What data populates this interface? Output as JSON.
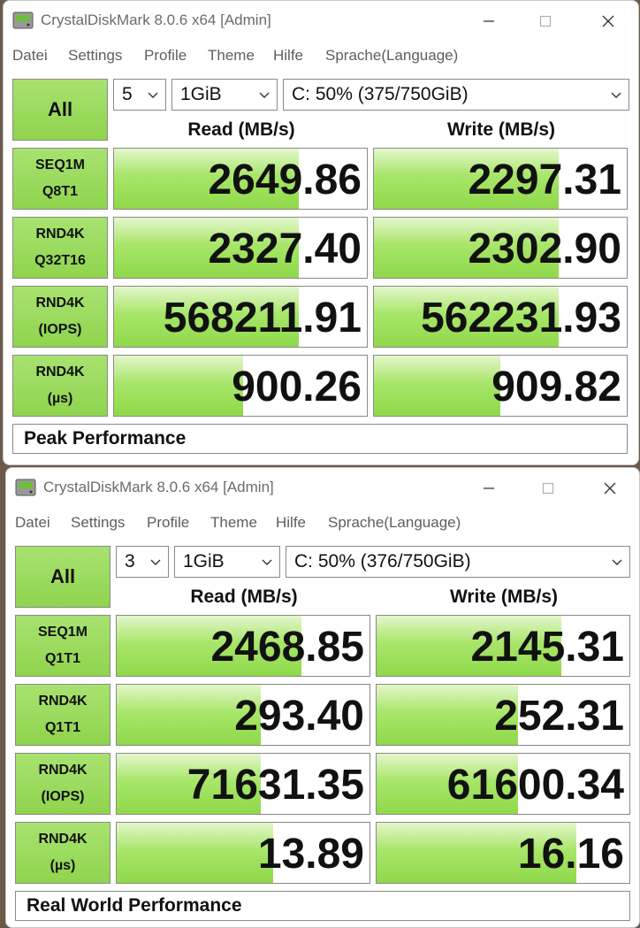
{
  "windows": [
    {
      "title": "CrystalDiskMark 8.0.6 x64 [Admin]",
      "menu": [
        "Datei",
        "Settings",
        "Profile",
        "Theme",
        "Hilfe",
        "Sprache(Language)"
      ],
      "all_label": "All",
      "count": "5",
      "size": "1GiB",
      "drive": "C: 50% (375/750GiB)",
      "read_header": "Read (MB/s)",
      "write_header": "Write (MB/s)",
      "rows": [
        {
          "label1": "SEQ1M",
          "label2": "Q8T1",
          "read": "2649.86",
          "write": "2297.31",
          "read_fill": 0.73,
          "write_fill": 0.73
        },
        {
          "label1": "RND4K",
          "label2": "Q32T16",
          "read": "2327.40",
          "write": "2302.90",
          "read_fill": 0.73,
          "write_fill": 0.73
        },
        {
          "label1": "RND4K",
          "label2": "(IOPS)",
          "read": "568211.91",
          "write": "562231.93",
          "read_fill": 0.73,
          "write_fill": 0.73
        },
        {
          "label1": "RND4K",
          "label2": "(µs)",
          "read": "900.26",
          "write": "909.82",
          "read_fill": 0.51,
          "write_fill": 0.5
        }
      ],
      "footer": "Peak Performance"
    },
    {
      "title": "CrystalDiskMark 8.0.6 x64 [Admin]",
      "menu": [
        "Datei",
        "Settings",
        "Profile",
        "Theme",
        "Hilfe",
        "Sprache(Language)"
      ],
      "all_label": "All",
      "count": "3",
      "size": "1GiB",
      "drive": "C: 50% (376/750GiB)",
      "read_header": "Read (MB/s)",
      "write_header": "Write (MB/s)",
      "rows": [
        {
          "label1": "SEQ1M",
          "label2": "Q1T1",
          "read": "2468.85",
          "write": "2145.31",
          "read_fill": 0.73,
          "write_fill": 0.73
        },
        {
          "label1": "RND4K",
          "label2": "Q1T1",
          "read": "293.40",
          "write": "252.31",
          "read_fill": 0.57,
          "write_fill": 0.56
        },
        {
          "label1": "RND4K",
          "label2": "(IOPS)",
          "read": "71631.35",
          "write": "61600.34",
          "read_fill": 0.57,
          "write_fill": 0.56
        },
        {
          "label1": "RND4K",
          "label2": "(µs)",
          "read": "13.89",
          "write": "16.16",
          "read_fill": 0.62,
          "write_fill": 0.79
        }
      ],
      "footer": "Real World Performance"
    }
  ],
  "colors": {
    "accent_green": "#8fd44e",
    "bar_green": "#a8e66a"
  }
}
